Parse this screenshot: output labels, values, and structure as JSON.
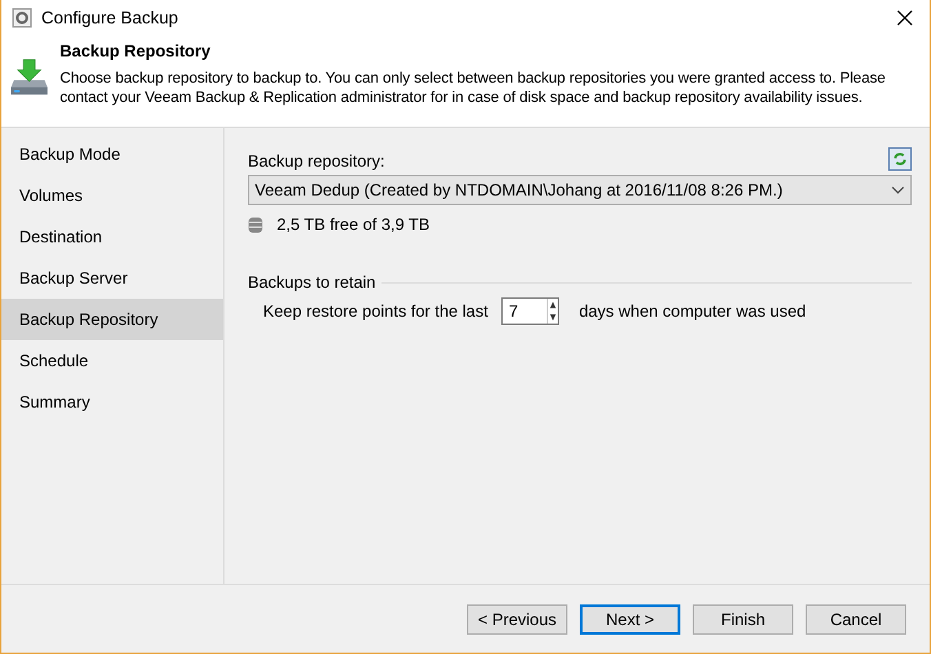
{
  "window": {
    "title": "Configure Backup"
  },
  "header": {
    "title": "Backup Repository",
    "description": "Choose backup repository to backup to. You can only select between backup repositories you were granted access to. Please contact your Veeam Backup & Replication administrator for in case of disk space and backup repository availability issues."
  },
  "sidebar": {
    "items": [
      {
        "label": "Backup Mode",
        "selected": false
      },
      {
        "label": "Volumes",
        "selected": false
      },
      {
        "label": "Destination",
        "selected": false
      },
      {
        "label": "Backup Server",
        "selected": false
      },
      {
        "label": "Backup Repository",
        "selected": true
      },
      {
        "label": "Schedule",
        "selected": false
      },
      {
        "label": "Summary",
        "selected": false
      }
    ]
  },
  "repository": {
    "label": "Backup repository:",
    "value": "Veeam Dedup (Created by NTDOMAIN\\Johang at 2016/11/08 8:26 PM.)",
    "free_space": "2,5 TB free of 3,9 TB"
  },
  "retention": {
    "group_title": "Backups to retain",
    "prefix": "Keep restore points for the last",
    "value": "7",
    "suffix": "days when computer was used"
  },
  "buttons": [
    {
      "label": "< Previous",
      "default": false
    },
    {
      "label": "Next >",
      "default": true
    },
    {
      "label": "Finish",
      "default": false
    },
    {
      "label": "Cancel",
      "default": false
    }
  ]
}
